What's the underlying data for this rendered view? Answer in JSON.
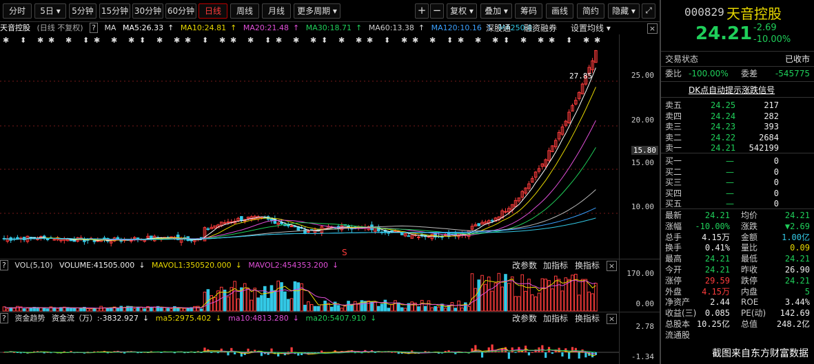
{
  "toolbar": {
    "periods": [
      "分时",
      "5日",
      "5分钟",
      "15分钟",
      "30分钟",
      "60分钟",
      "日线",
      "周线",
      "月线",
      "更多周期"
    ],
    "active": "日线",
    "icons": [
      "+",
      "−"
    ],
    "menus": [
      "复权",
      "叠加",
      "筹码",
      "画线",
      "简约",
      "隐藏"
    ]
  },
  "chart_header": {
    "name": "天音控股",
    "mode": "(日线 不复权)",
    "ma_label": "MA",
    "ma5": "MA5:26.33",
    "ma10": "MA10:24.81",
    "ma20": "MA20:21.48",
    "ma30": "MA30:18.71",
    "ma60": "MA60:13.38",
    "ma120": "MA120:10.16",
    "ma250": "MA250:8.",
    "tags": [
      "深股通",
      "融资融券"
    ],
    "setting": "设置均线"
  },
  "price_axis": {
    "labels": [
      "25.00",
      "20.00",
      "15.00",
      "10.00"
    ],
    "marker": "15.80",
    "high_label": "27.85",
    "s_marker": "S"
  },
  "vol": {
    "title": "VOL(5,10)",
    "volume": "VOLUME:41505.000",
    "mavol1": "MAVOL1:350520.000",
    "mavol2": "MAVOL2:454353.200",
    "axis": [
      "170.00",
      "0.00"
    ],
    "buttons": [
      "改参数",
      "加指标",
      "换指标"
    ]
  },
  "flow": {
    "title": "资金趋势",
    "value": "资金流（万）:-3832.927",
    "ma5": "ma5:2975.402",
    "ma10": "ma10:4813.280",
    "ma20": "ma20:5407.910",
    "axis": [
      "2.78",
      "-1.34"
    ],
    "buttons": [
      "改参数",
      "加指标",
      "换指标"
    ]
  },
  "quote": {
    "code": "000829",
    "name": "天音控股",
    "price": "24.21",
    "change": "-2.69",
    "pct": "-10.00%",
    "status_label": "交易状态",
    "status": "已收市",
    "weibi_label": "委比",
    "weibi": "-100.00%",
    "weicha_label": "委差",
    "weicha": "-545775",
    "dk": "DK点自动提示涨跌信号",
    "asks": [
      {
        "label": "卖五",
        "price": "24.25",
        "vol": "217"
      },
      {
        "label": "卖四",
        "price": "24.24",
        "vol": "282"
      },
      {
        "label": "卖三",
        "price": "24.23",
        "vol": "393"
      },
      {
        "label": "卖二",
        "price": "24.22",
        "vol": "2684"
      },
      {
        "label": "卖一",
        "price": "24.21",
        "vol": "542199"
      }
    ],
    "bids": [
      {
        "label": "买一",
        "price": "—",
        "vol": "0"
      },
      {
        "label": "买二",
        "price": "—",
        "vol": "0"
      },
      {
        "label": "买三",
        "price": "—",
        "vol": "0"
      },
      {
        "label": "买四",
        "price": "—",
        "vol": "0"
      },
      {
        "label": "买五",
        "price": "—",
        "vol": "0"
      }
    ],
    "stats": [
      {
        "l1": "最新",
        "v1": "24.21",
        "c1": "green",
        "l2": "均价",
        "v2": "24.21",
        "c2": "green"
      },
      {
        "l1": "涨幅",
        "v1": "-10.00%",
        "c1": "green",
        "l2": "涨跌",
        "v2": "▼2.69",
        "c2": "green"
      },
      {
        "l1": "总手",
        "v1": "4.15万",
        "c1": "white",
        "l2": "金额",
        "v2": "1.00亿",
        "c2": "cyan"
      },
      {
        "l1": "换手",
        "v1": "0.41%",
        "c1": "white",
        "l2": "量比",
        "v2": "0.09",
        "c2": "yellow"
      },
      {
        "l1": "最高",
        "v1": "24.21",
        "c1": "green",
        "l2": "最低",
        "v2": "24.21",
        "c2": "green"
      },
      {
        "l1": "今开",
        "v1": "24.21",
        "c1": "green",
        "l2": "昨收",
        "v2": "26.90",
        "c2": "white"
      },
      {
        "l1": "涨停",
        "v1": "29.59",
        "c1": "red",
        "l2": "跌停",
        "v2": "24.21",
        "c2": "green"
      },
      {
        "l1": "外盘",
        "v1": "4.15万",
        "c1": "red",
        "l2": "内盘",
        "v2": "5",
        "c2": "green"
      },
      {
        "l1": "净资产",
        "v1": "2.44",
        "c1": "white",
        "l2": "ROE",
        "v2": "3.44%",
        "c2": "white"
      },
      {
        "l1": "收益(三)",
        "v1": "0.085",
        "c1": "white",
        "l2": "PE(动)",
        "v2": "142.69",
        "c2": "white"
      },
      {
        "l1": "总股本",
        "v1": "10.25亿",
        "c1": "white",
        "l2": "总值",
        "v2": "248.2亿",
        "c2": "white"
      },
      {
        "l1": "流通股",
        "v1": "",
        "c1": "white",
        "l2": "",
        "v2": "",
        "c2": "white"
      }
    ]
  },
  "watermark": "截图来自东方财富数据",
  "colors": {
    "up": "#ff3c3c",
    "down": "#33c9e6",
    "ma5": "#ffffff",
    "ma10": "#e8d800",
    "ma20": "#e04fd8",
    "ma30": "#1fcf5a",
    "ma60": "#bbbbbb",
    "ma120": "#3aa0ff",
    "ma250": "#33c9e6"
  }
}
